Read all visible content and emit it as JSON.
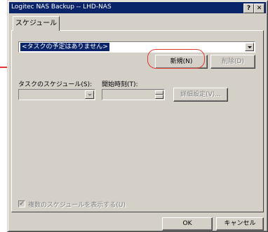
{
  "window": {
    "title": "Logitec NAS Backup -- LHD-NAS",
    "help_button": "?",
    "close_button": "✕"
  },
  "tab": {
    "label": "スケジュール"
  },
  "task_combo": {
    "value": "<タスクの予定はありません>"
  },
  "buttons": {
    "new_label": "新規(N)",
    "delete_label": "削除(D)",
    "advanced_label": "詳細設定(V)...",
    "ok_label": "OK",
    "cancel_label": "キャンセル"
  },
  "schedule": {
    "schedule_label": "タスクのスケジュール(S):",
    "start_time_label": "開始時刻(T):"
  },
  "multiple_schedules": {
    "label": "複数のスケジュールを表示する(U)",
    "checked": true
  },
  "colors": {
    "titlebar": "#0a246a",
    "callout": "#e0392f",
    "face": "#d4d0c8"
  }
}
